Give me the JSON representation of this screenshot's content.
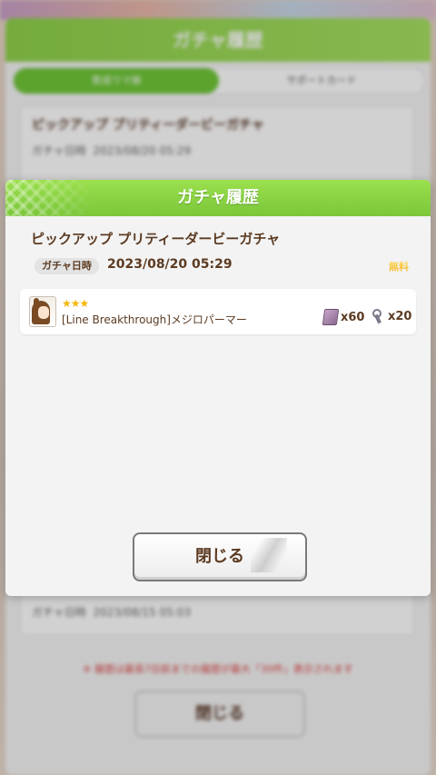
{
  "background": {
    "header_title": "ガチャ履歴",
    "tabs": [
      "育成ウマ娘",
      "サポートカード"
    ],
    "items": [
      {
        "name": "ピックアップ プリティーダービーガチャ",
        "date_label": "ガチャ日時",
        "date": "2023/08/20 05:29"
      },
      {
        "date_label": "ガチャ日時",
        "date": "2023/08/15 05:03"
      }
    ],
    "note": "※ 履歴は最長7日前までの履歴が最大「30件」表示されます",
    "close_label": "閉じる"
  },
  "dialog": {
    "title": "ガチャ履歴",
    "gacha_name": "ピックアップ プリティーダービーガチャ",
    "date_label": "ガチャ日時",
    "date_value": "2023/08/20 05:29",
    "cost_badge": "無料",
    "result": {
      "stars": "★★★",
      "star_count": 3,
      "card_name": "[Line Breakthrough]メジロパーマー",
      "rewards": [
        {
          "icon": "memory-piece-icon",
          "amount": "x60"
        },
        {
          "icon": "key-icon",
          "amount": "x20"
        }
      ]
    },
    "close_label": "閉じる"
  },
  "colors": {
    "header_green": "#8fd24b",
    "text_brown": "#5c3b22",
    "star_gold": "#f2b705"
  }
}
